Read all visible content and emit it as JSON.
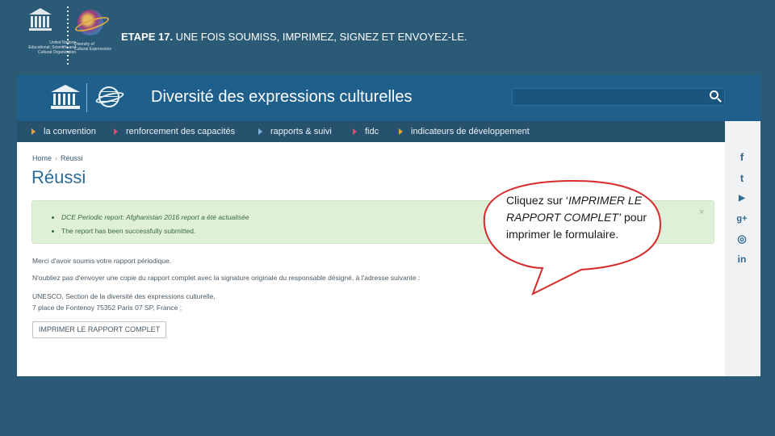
{
  "slide": {
    "title_step": "ETAPE 17.",
    "title_text": " UNE FOIS SOUMISS, IMPRIMEZ, SIGNEZ ET ENVOYEZ-LE.",
    "unesco_text": "United Nations\nEducational, Scientific and\nCultural Organization",
    "globe_text": "Diversity of\nCultural Expressions"
  },
  "site": {
    "title": "Diversité des expressions culturelles",
    "search_placeholder": "",
    "nav": [
      {
        "label": "la convention"
      },
      {
        "label": "renforcement des capacités"
      },
      {
        "label": "rapports & suivi"
      },
      {
        "label": "fidc"
      },
      {
        "label": "indicateurs de développement"
      }
    ],
    "social": [
      {
        "icon": "facebook-icon",
        "glyph": "f"
      },
      {
        "icon": "twitter-icon",
        "glyph": "t"
      },
      {
        "icon": "youtube-icon",
        "glyph": "▶"
      },
      {
        "icon": "google-plus-icon",
        "glyph": "g+"
      },
      {
        "icon": "instagram-icon",
        "glyph": "◎"
      },
      {
        "icon": "linkedin-icon",
        "glyph": "in"
      }
    ]
  },
  "breadcrumb": {
    "home": "Home",
    "sep": "›",
    "current": "Réussi"
  },
  "page_title": "Réussi",
  "alert": {
    "items": [
      "DCE Periodic report: Afghanistan 2016 report a été actualisée",
      "The report has been successfully submitted."
    ],
    "close": "×"
  },
  "body": {
    "thanks": "Merci d'avoir soumis votre rapport périodique.",
    "reminder": "N'oubliez pas d'envoyer une copie du rapport complet avec la signature originale du responsable désigné, à l'adresse suivante :",
    "address_line1": "UNESCO, Section de la diversité des expressions culturelle,",
    "address_line2": "7 place de Fontenoy 75352 Paris 07 SP, France ;",
    "print_button": "IMPRIMER LE RAPPORT COMPLET"
  },
  "callout": {
    "prefix": "Cliquez sur ‘",
    "emph": "IMPRIMER LE RAPPORT COMPLET’",
    "suffix": " pour imprimer le formulaire."
  },
  "colors": {
    "background": "#2b5a76",
    "site_header": "#1e5f8c",
    "nav": "#27526e",
    "alert_bg": "#dff0d8",
    "callout_border": "#d62b2b",
    "title_blue": "#2b6a98"
  }
}
